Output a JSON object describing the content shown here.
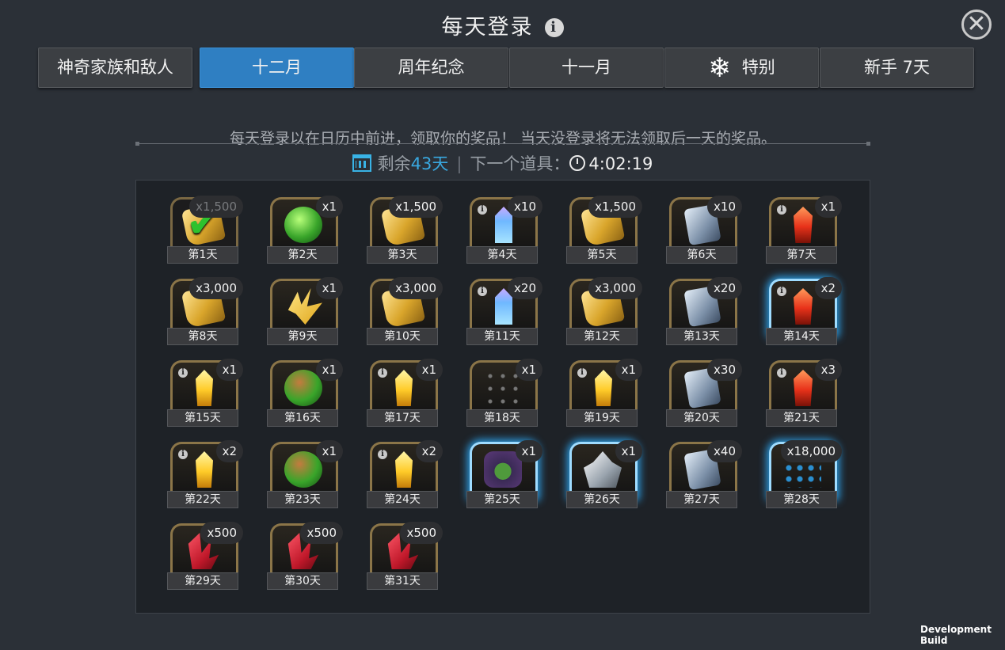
{
  "header": {
    "title": "每天登录",
    "info_icon": "info-icon",
    "close_icon": "close-icon"
  },
  "tabs": [
    {
      "label": "神奇家族和敌人",
      "active": false
    },
    {
      "label": "十二月",
      "active": true
    },
    {
      "label": "周年纪念",
      "active": false
    },
    {
      "label": "十一月",
      "active": false
    },
    {
      "label": "特别",
      "active": false,
      "icon": "snowflake-icon"
    },
    {
      "label": "新手 7天",
      "active": false
    }
  ],
  "description": "每天登录以在日历中前进，领取你的奖品！ 当天没登录将无法领取后一天的奖品。",
  "status": {
    "remaining_prefix": "剩余",
    "remaining_days": "43",
    "remaining_suffix": "天",
    "separator": "|",
    "next_item_label": "下一个道具：",
    "countdown": "4:02:19"
  },
  "rewards": [
    {
      "day": "第1天",
      "qty": "x1,500",
      "item": "gold",
      "claimed": true
    },
    {
      "day": "第2天",
      "qty": "x1",
      "item": "orb"
    },
    {
      "day": "第3天",
      "qty": "x1,500",
      "item": "gold"
    },
    {
      "day": "第4天",
      "qty": "x10",
      "item": "crystal-blue",
      "info": true
    },
    {
      "day": "第5天",
      "qty": "x1,500",
      "item": "gold"
    },
    {
      "day": "第6天",
      "qty": "x10",
      "item": "card"
    },
    {
      "day": "第7天",
      "qty": "x1",
      "item": "crystal-red",
      "info": true
    },
    {
      "day": "第8天",
      "qty": "x3,000",
      "item": "gold"
    },
    {
      "day": "第9天",
      "qty": "x1",
      "item": "shard"
    },
    {
      "day": "第10天",
      "qty": "x3,000",
      "item": "gold"
    },
    {
      "day": "第11天",
      "qty": "x20",
      "item": "crystal-blue",
      "info": true
    },
    {
      "day": "第12天",
      "qty": "x3,000",
      "item": "gold"
    },
    {
      "day": "第13天",
      "qty": "x20",
      "item": "card"
    },
    {
      "day": "第14天",
      "qty": "x2",
      "item": "crystal-red",
      "info": true,
      "highlight": true
    },
    {
      "day": "第15天",
      "qty": "x1",
      "item": "crystal-gold",
      "info": true
    },
    {
      "day": "第16天",
      "qty": "x1",
      "item": "orb2"
    },
    {
      "day": "第17天",
      "qty": "x1",
      "item": "crystal-gold",
      "info": true
    },
    {
      "day": "第18天",
      "qty": "x1",
      "item": "network"
    },
    {
      "day": "第19天",
      "qty": "x1",
      "item": "crystal-gold",
      "info": true
    },
    {
      "day": "第20天",
      "qty": "x30",
      "item": "card"
    },
    {
      "day": "第21天",
      "qty": "x3",
      "item": "crystal-red",
      "info": true
    },
    {
      "day": "第22天",
      "qty": "x2",
      "item": "crystal-gold",
      "info": true
    },
    {
      "day": "第23天",
      "qty": "x1",
      "item": "orb2"
    },
    {
      "day": "第24天",
      "qty": "x2",
      "item": "crystal-gold",
      "info": true
    },
    {
      "day": "第25天",
      "qty": "x1",
      "item": "champion",
      "highlight": true
    },
    {
      "day": "第26天",
      "qty": "x1",
      "item": "silver",
      "highlight": true
    },
    {
      "day": "第27天",
      "qty": "x40",
      "item": "card"
    },
    {
      "day": "第28天",
      "qty": "x18,000",
      "item": "blue-network",
      "highlight": true
    },
    {
      "day": "第29天",
      "qty": "x500",
      "item": "red-shard"
    },
    {
      "day": "第30天",
      "qty": "x500",
      "item": "red-shard"
    },
    {
      "day": "第31天",
      "qty": "x500",
      "item": "red-shard"
    }
  ],
  "footer": {
    "dev_build": "Development Build"
  }
}
